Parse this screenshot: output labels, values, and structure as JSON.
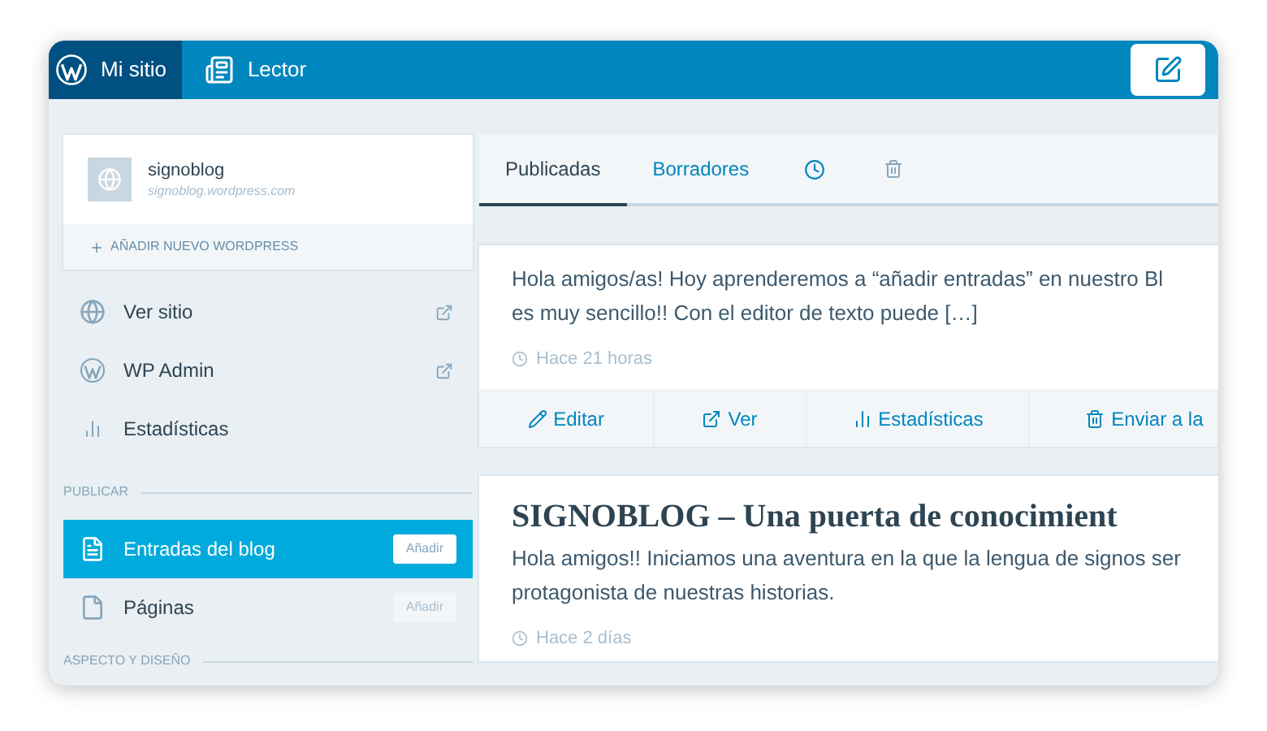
{
  "top_bar": {
    "tabs": [
      {
        "kind": "site",
        "label": "Mi sitio",
        "selected": true
      },
      {
        "kind": "reader",
        "label": "Lector",
        "selected": false
      }
    ]
  },
  "sidebar": {
    "site": {
      "name": "signoblog",
      "url": "signoblog.wordpress.com"
    },
    "add_site": "AÑADIR NUEVO WORDPRESS",
    "items": [
      {
        "kind": "globe",
        "label": "Ver sitio",
        "external": true
      },
      {
        "kind": "wp",
        "label": "WP Admin",
        "external": true
      },
      {
        "kind": "stats",
        "label": "Estadísticas",
        "external": false
      }
    ],
    "sections": [
      {
        "heading": "PUBLICAR",
        "items": [
          {
            "kind": "posts",
            "label": "Entradas del blog",
            "action": "Añadir",
            "selected": true
          },
          {
            "kind": "page",
            "label": "Páginas",
            "action": "Añadir",
            "selected": false
          }
        ]
      },
      {
        "heading": "ASPECTO Y DISEÑO"
      }
    ]
  },
  "tabs": [
    {
      "label": "Publicadas",
      "selected": true
    },
    {
      "label": "Borradores",
      "selected": false
    }
  ],
  "posts": [
    {
      "excerpt": "Hola amigos/as! Hoy aprenderemos a “añadir entradas” en nuestro Bl",
      "excerpt_2": "es muy sencillo!! Con el editor de texto puede […]",
      "time": "Hace 21 horas",
      "actions": [
        {
          "kind": "edit",
          "label": "Editar"
        },
        {
          "kind": "view",
          "label": "Ver"
        },
        {
          "kind": "stats",
          "label": "Estadísticas"
        },
        {
          "kind": "trash",
          "label": "Enviar a la"
        }
      ]
    },
    {
      "title": "SIGNOBLOG – Una puerta de conocimient",
      "excerpt": "Hola amigos!! Iniciamos una aventura en la que la lengua de signos ser",
      "excerpt_2": "protagonista de nuestras historias.",
      "time": "Hace 2 días"
    }
  ]
}
